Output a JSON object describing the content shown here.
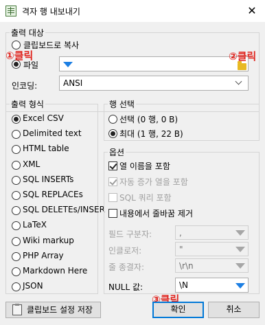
{
  "window": {
    "title": "격자 행 내보내기",
    "close_glyph": "✕"
  },
  "target": {
    "legend": "출력 대상",
    "clipboard_label": "클립보드로 복사",
    "file_label": "파일",
    "file_value": "",
    "selected": "file",
    "encoding_label": "인코딩:",
    "encoding_value": "ANSI"
  },
  "format": {
    "legend": "출력 형식",
    "options": [
      {
        "label": "Excel CSV",
        "checked": true
      },
      {
        "label": "Delimited text",
        "checked": false
      },
      {
        "label": "HTML table",
        "checked": false
      },
      {
        "label": "XML",
        "checked": false
      },
      {
        "label": "SQL INSERTs",
        "checked": false
      },
      {
        "label": "SQL REPLACEs",
        "checked": false
      },
      {
        "label": "SQL DELETEs/INSER",
        "checked": false
      },
      {
        "label": "LaTeX",
        "checked": false
      },
      {
        "label": "Wiki markup",
        "checked": false
      },
      {
        "label": "PHP Array",
        "checked": false
      },
      {
        "label": "Markdown Here",
        "checked": false
      },
      {
        "label": "JSON",
        "checked": false
      }
    ]
  },
  "rows": {
    "legend": "행 선택",
    "selection_label": "선택 (0 행, 0 B)",
    "all_label": "최대 (1 행, 22 B)",
    "selected": "all"
  },
  "options": {
    "legend": "옵션",
    "include_column_names": {
      "label": "열 이름을 포함",
      "checked": true,
      "enabled": true
    },
    "include_auto_increment": {
      "label": "자동 증가 열을 포함",
      "checked": true,
      "enabled": false
    },
    "include_sql_query": {
      "label": "SQL 쿼리 포함",
      "checked": false,
      "enabled": false
    },
    "remove_linebreaks": {
      "label": "내용에서 줄바꿈 제거",
      "checked": false,
      "enabled": true
    },
    "field_separator_label": "필드 구분자:",
    "field_separator_value": ",",
    "encloser_label": "인클로저:",
    "encloser_value": "\"",
    "line_terminator_label": "줄 종결자:",
    "line_terminator_value": "\\r\\n",
    "null_label": "NULL 값:",
    "null_value": "\\N"
  },
  "buttons": {
    "save_clipboard_settings": "클립보드 설정 저장",
    "ok": "확인",
    "cancel": "취소"
  },
  "annotations": {
    "callout_1": "①클릭",
    "callout_2": "②클릭",
    "callout_3": "③클릭",
    "color": "#e0241e"
  },
  "colors": {
    "accent_blue": "#1d7fe3",
    "folder_yellow": "#e8b923",
    "default_button_border": "#0078d7"
  }
}
